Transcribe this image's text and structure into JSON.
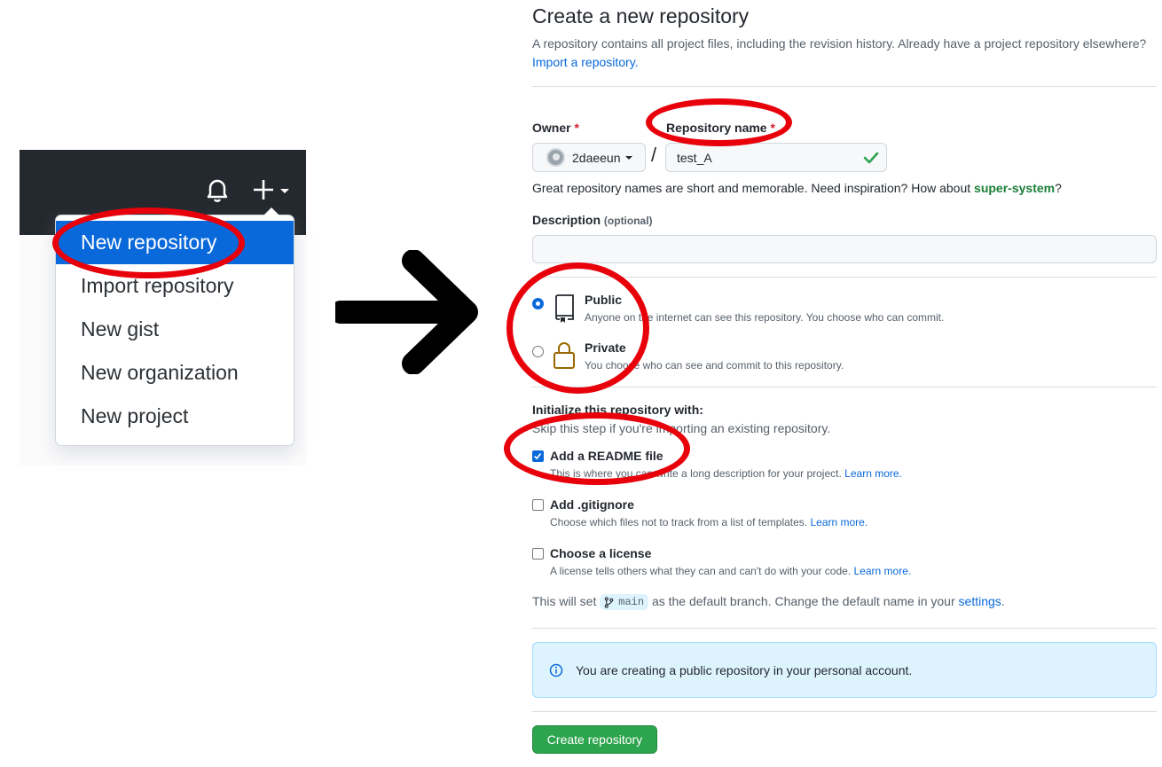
{
  "dropdown": {
    "items": [
      {
        "label": "New repository",
        "active": true
      },
      {
        "label": "Import repository"
      },
      {
        "label": "New gist"
      },
      {
        "label": "New organization"
      },
      {
        "label": "New project"
      }
    ]
  },
  "icons": {
    "bell": "bell-icon",
    "plus": "plus-icon",
    "arrow": "right-arrow-icon"
  },
  "form": {
    "title": "Create a new repository",
    "subtitle": "A repository contains all project files, including the revision history. Already have a project repository elsewhere?",
    "import_link": "Import a repository.",
    "owner_label": "Owner",
    "required_mark": "*",
    "owner_value": "2daeeun",
    "slash": "/",
    "repo_name_label": "Repository name",
    "repo_name_value": "test_A",
    "hint_text": "Great repository names are short and memorable. Need inspiration? How about",
    "hint_suggestion": "super-system",
    "hint_end": "?",
    "description_label": "Description",
    "description_optional": "(optional)",
    "description_value": "",
    "public_title": "Public",
    "public_desc": "Anyone on the internet can see this repository. You choose who can commit.",
    "private_title": "Private",
    "private_desc": "You choose who can see and commit to this repository.",
    "init_title": "Initialize this repository with:",
    "init_desc": "Skip this step if you're importing an existing repository.",
    "readme_label": "Add a README file",
    "readme_desc": "This is where you can write a long description for your project.",
    "gitignore_label": "Add .gitignore",
    "gitignore_desc": "Choose which files not to track from a list of templates.",
    "license_label": "Choose a license",
    "license_desc": "A license tells others what they can and can't do with your code.",
    "learn_more": "Learn more.",
    "branch_prefix": "This will set",
    "branch_name": "main",
    "branch_suffix": "as the default branch. Change the default name in your",
    "settings_link": "settings",
    "period": ".",
    "notice": "You are creating a public repository in your personal account.",
    "create_button": "Create repository"
  },
  "colors": {
    "accent": "#0969da",
    "success": "#2da44e",
    "annotation": "#e8000a"
  }
}
